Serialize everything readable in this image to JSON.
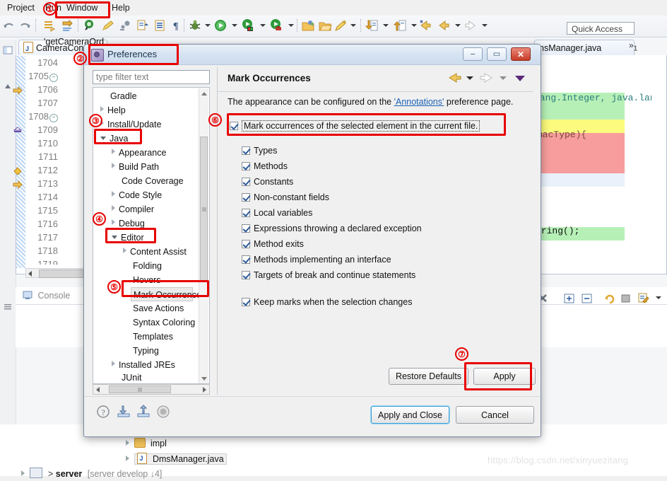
{
  "menubar": {
    "items": [
      {
        "label": "Project"
      },
      {
        "label": "Run"
      },
      {
        "label": "Window"
      },
      {
        "label": "Help"
      }
    ]
  },
  "toolbar": {
    "quick_access_placeholder": "Quick Access",
    "icons": [
      "undo-icon",
      "redo-icon",
      "save-all-icon",
      "publish-icon",
      "debug-last-icon",
      "pencil-icon",
      "run-external-icon",
      "open-task-icon",
      "open-type-icon",
      "paragraph-icon",
      "debug-icon",
      "run-icon",
      "run-server-icon",
      "debug-server-icon",
      "new-java-project-icon",
      "open-folder-icon",
      "edit-icon",
      "import-icon",
      "export-icon",
      "back-icon",
      "prev-annotation-icon",
      "next-annotation-icon"
    ]
  },
  "editor": {
    "tabs": [
      {
        "label": "CameraCont",
        "icon": "java-file-icon",
        "active": true
      },
      {
        "label": "nsManager.java",
        "icon": "java-file-icon",
        "active": false
      }
    ],
    "overflow_badge": "1",
    "line_numbers": [
      {
        "n": "1704",
        "fold": false,
        "marker": null
      },
      {
        "n": "1705",
        "fold": true,
        "marker": null
      },
      {
        "n": "1706",
        "fold": false,
        "marker": "arrow-marker"
      },
      {
        "n": "1707",
        "fold": false,
        "marker": null
      },
      {
        "n": "1708",
        "fold": true,
        "marker": null
      },
      {
        "n": "1709",
        "fold": false,
        "marker": "override-marker"
      },
      {
        "n": "1710",
        "fold": false,
        "marker": null
      },
      {
        "n": "1711",
        "fold": false,
        "marker": null
      },
      {
        "n": "1712",
        "fold": false,
        "marker": "bookmark-marker"
      },
      {
        "n": "1713",
        "fold": false,
        "marker": "arrow-marker"
      },
      {
        "n": "1714",
        "fold": false,
        "marker": null
      },
      {
        "n": "1715",
        "fold": false,
        "marker": null
      },
      {
        "n": "1716",
        "fold": false,
        "marker": null
      },
      {
        "n": "1717",
        "fold": false,
        "marker": null
      },
      {
        "n": "1718",
        "fold": false,
        "marker": null
      },
      {
        "n": "1719",
        "fold": false,
        "marker": null
      }
    ],
    "code_fragments": [
      {
        "text": "lang.Integer, java.lang",
        "color": "#2a7d7d"
      },
      {
        "text": "macType){",
        "color": "#7a4a3a"
      },
      {
        "text": "tring();",
        "color": "#111111"
      }
    ],
    "highlights": [
      {
        "color": "#b7f0b7",
        "label": "added-lines-highlight"
      },
      {
        "color": "#fbfb7d",
        "label": "changed-lines-highlight"
      },
      {
        "color": "#f79d9d",
        "label": "removed-lines-highlight"
      }
    ]
  },
  "console": {
    "tab_label": "Console",
    "text": "'getCameraOrd",
    "toolbar_icons": [
      "terminate-all-icon",
      "expand-icon",
      "collapse-icon",
      "relaunch-icon",
      "stop-icon",
      "open-console-icon",
      "chevron-down-icon"
    ]
  },
  "package_explorer": {
    "rows": [
      {
        "label": "impl",
        "icon": "folder-icon",
        "indent": 178,
        "selected": false
      },
      {
        "label": "DmsManager.java",
        "icon": "java-file-icon",
        "indent": 178,
        "selected": true
      },
      {
        "label": "server",
        "suffix": "[server develop ↓4]",
        "icon": "project-icon",
        "indent": 30,
        "selected": false
      }
    ]
  },
  "preferences": {
    "title": "Preferences",
    "window_buttons": {
      "minimize": "–",
      "maximize": "▭",
      "close": "✕"
    },
    "filter_placeholder": "type filter text",
    "tree": [
      {
        "label": "Gradle",
        "indent": 24,
        "arrow": "none",
        "selected": false
      },
      {
        "label": "Help",
        "indent": 10,
        "arrow": "closed",
        "selected": false
      },
      {
        "label": "Install/Update",
        "indent": 10,
        "arrow": "closed",
        "selected": false
      },
      {
        "label": "Java",
        "indent": 10,
        "arrow": "open",
        "selected": false
      },
      {
        "label": "Appearance",
        "indent": 26,
        "arrow": "closed",
        "selected": false
      },
      {
        "label": "Build Path",
        "indent": 26,
        "arrow": "closed",
        "selected": false
      },
      {
        "label": "Code Coverage",
        "indent": 40,
        "arrow": "none",
        "selected": false
      },
      {
        "label": "Code Style",
        "indent": 26,
        "arrow": "closed",
        "selected": false
      },
      {
        "label": "Compiler",
        "indent": 26,
        "arrow": "closed",
        "selected": false
      },
      {
        "label": "Debug",
        "indent": 26,
        "arrow": "closed",
        "selected": false
      },
      {
        "label": "Editor",
        "indent": 26,
        "arrow": "open",
        "selected": false
      },
      {
        "label": "Content Assist",
        "indent": 42,
        "arrow": "closed",
        "selected": false
      },
      {
        "label": "Folding",
        "indent": 56,
        "arrow": "none",
        "selected": false
      },
      {
        "label": "Hovers",
        "indent": 56,
        "arrow": "none",
        "selected": false
      },
      {
        "label": "Mark Occurrence",
        "indent": 56,
        "arrow": "none",
        "selected": true
      },
      {
        "label": "Save Actions",
        "indent": 56,
        "arrow": "none",
        "selected": false
      },
      {
        "label": "Syntax Coloring",
        "indent": 56,
        "arrow": "none",
        "selected": false
      },
      {
        "label": "Templates",
        "indent": 56,
        "arrow": "none",
        "selected": false
      },
      {
        "label": "Typing",
        "indent": 56,
        "arrow": "none",
        "selected": false
      },
      {
        "label": "Installed JREs",
        "indent": 26,
        "arrow": "closed",
        "selected": false
      },
      {
        "label": "JUnit",
        "indent": 40,
        "arrow": "none",
        "selected": false
      }
    ],
    "page": {
      "title": "Mark Occurrences",
      "description_before": "The appearance can be configured on the ",
      "description_link": "'Annotations'",
      "description_after": " preference page.",
      "master_checkbox": {
        "label": "Mark occurrences of the selected element in the current file.",
        "checked": true
      },
      "options": [
        {
          "label": "Types",
          "checked": true
        },
        {
          "label": "Methods",
          "checked": true
        },
        {
          "label": "Constants",
          "checked": true
        },
        {
          "label": "Non-constant fields",
          "checked": true
        },
        {
          "label": "Local variables",
          "checked": true
        },
        {
          "label": "Expressions throwing a declared exception",
          "checked": true
        },
        {
          "label": "Method exits",
          "checked": true
        },
        {
          "label": "Methods implementing an interface",
          "checked": true
        },
        {
          "label": "Targets of break and continue statements",
          "checked": true
        }
      ],
      "keep_marks": {
        "label": "Keep marks when the selection changes",
        "checked": true
      },
      "restore_defaults_label": "Restore Defaults",
      "apply_label": "Apply"
    },
    "footer": {
      "icons": [
        "help-icon",
        "import-preferences-icon",
        "export-preferences-icon",
        "info-icon"
      ],
      "apply_and_close_label": "Apply and Close",
      "cancel_label": "Cancel"
    }
  },
  "annotations": {
    "markers": [
      {
        "num": "①",
        "target": "window-menu"
      },
      {
        "num": "②",
        "target": "preferences-title"
      },
      {
        "num": "③",
        "target": "tree-java"
      },
      {
        "num": "④",
        "target": "tree-editor"
      },
      {
        "num": "⑤",
        "target": "tree-mark-occurrence"
      },
      {
        "num": "⑥",
        "target": "master-checkbox"
      },
      {
        "num": "⑦",
        "target": "apply-button"
      }
    ],
    "accent_color": "#e80000"
  },
  "watermark": {
    "text": "https://blog.csdn.net/xinyuezitang"
  }
}
